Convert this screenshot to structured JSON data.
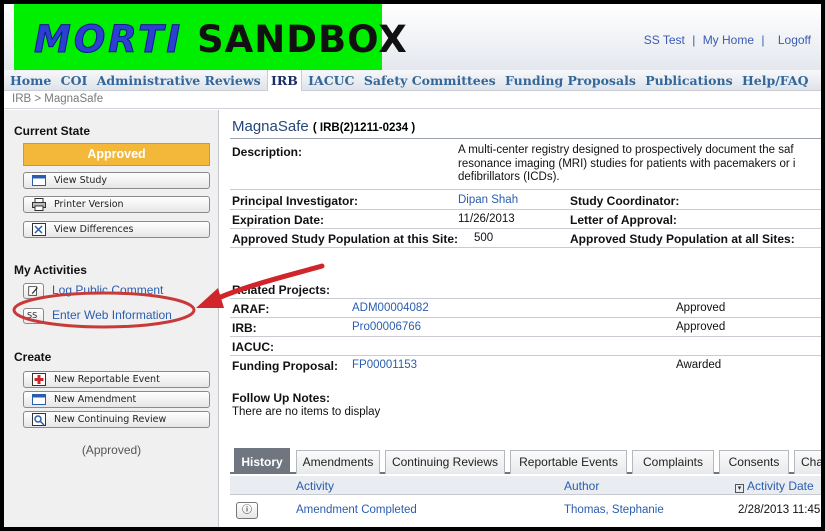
{
  "app": {
    "logo_mort": "MORTI",
    "logo_sandbox": "SANDBOX"
  },
  "top_links": {
    "user": "SS Test",
    "sep1": "|",
    "my_home": "My Home",
    "sep2": "|",
    "logoff": "Logoff"
  },
  "nav": [
    "Home",
    "COI",
    "Administrative Reviews",
    "IRB",
    "IACUC",
    "Safety Committees",
    "Funding Proposals",
    "Publications",
    "Help/FAQ"
  ],
  "breadcrumb": "IRB  >  MagnaSafe",
  "sidebar": {
    "current_state_title": "Current State",
    "status": "Approved",
    "buttons": [
      "View Study",
      "Printer Version",
      "View Differences"
    ],
    "my_activities_title": "My Activities",
    "activities": [
      "Log Public Comment",
      "Enter Web Information"
    ],
    "ss_badge": "SS",
    "create_title": "Create",
    "create_buttons": [
      "New Reportable Event",
      "New Amendment",
      "New Continuing Review"
    ],
    "footer": "(Approved)"
  },
  "study": {
    "name": "MagnaSafe",
    "id": "( IRB(2)1211-0234 )",
    "description_label": "Description:",
    "description": "A multi-center registry designed to prospectively document the saf resonance imaging (MRI) studies for patients with pacemakers or i defibrillators (ICDs).",
    "pi_label": "Principal Investigator:",
    "pi": "Dipan Shah",
    "coordinator_label": "Study Coordinator:",
    "expiration_label": "Expiration Date:",
    "expiration": "11/26/2013",
    "letter_label": "Letter of Approval:",
    "pop_site_label": "Approved Study Population at this Site:",
    "pop_site": "500",
    "pop_all_label": "Approved Study Population at all Sites:"
  },
  "related": {
    "title": "Related Projects:",
    "rows": [
      {
        "label": "ARAF:",
        "id": "ADM00004082",
        "status": "Approved"
      },
      {
        "label": "IRB:",
        "id": "Pro00006766",
        "status": "Approved"
      },
      {
        "label": "IACUC:",
        "id": "",
        "status": ""
      },
      {
        "label": "Funding Proposal:",
        "id": "FP00001153",
        "status": "Awarded"
      }
    ]
  },
  "followup": {
    "title": "Follow Up Notes:",
    "text": "There are no items to display"
  },
  "tabs": [
    "History",
    "Amendments",
    "Continuing Reviews",
    "Reportable Events",
    "Complaints",
    "Consents",
    "Chang"
  ],
  "history": {
    "columns": [
      "Activity",
      "Author",
      "Activity Date"
    ],
    "rows": [
      {
        "activity": "Amendment Completed",
        "author": "Thomas, Stephanie",
        "date": "2/28/2013 11:45"
      }
    ]
  },
  "colors": {
    "logo_bg": "#00ee00",
    "approved": "#f3b83a",
    "annotation": "#d0252b",
    "link": "#2a5db0"
  }
}
